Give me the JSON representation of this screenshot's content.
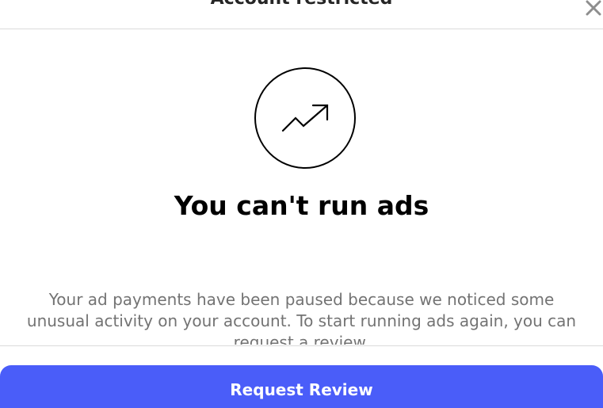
{
  "dialog": {
    "title": "Account restricted",
    "close_icon": "close-icon",
    "hero_icon": "trending-up-icon",
    "headline": "You can't run ads",
    "body": "Your ad payments have been paused because we noticed some unusual activity on your account. To start running ads again, you can request a review.",
    "primary_button_label": "Request Review"
  },
  "colors": {
    "primary": "#4a5df9",
    "title_text": "#262626",
    "body_text": "#737373",
    "divider": "#dbdbdb"
  }
}
